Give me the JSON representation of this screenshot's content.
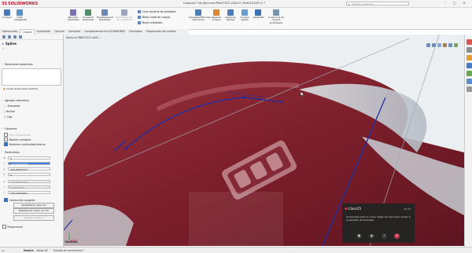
{
  "app": {
    "brand_ds": "3S",
    "brand_name": "SOLIDWORKS",
    "doc_title": "Croquis17 de Ejercicio PRACTICO-CASCO (Pint01)LE(P:1) *",
    "search_placeholder": "Buscar comandos"
  },
  "window": {
    "min": "–",
    "max": "□",
    "close": "✕"
  },
  "ribbon": {
    "big": [
      {
        "label": "Croquis",
        "color": "#4a79b8"
      },
      {
        "label": "Cota inteligente",
        "color": "#5d8fc9"
      },
      {
        "label": "Recortar entidades",
        "color": "#7a6fb0"
      },
      {
        "label": "Convertir entidades",
        "color": "#4d8f6d"
      },
      {
        "label": "Equidistanciar entidades",
        "color": "#6a86b3"
      },
      {
        "label": "Equidistanciar en superficie",
        "color": "#9aa7b8"
      }
    ],
    "small": [
      {
        "label": "Crear simetría de entidades",
        "color": "#5d86c1"
      },
      {
        "label": "Matriz lineal de croquis",
        "color": "#5d86c1"
      },
      {
        "label": "Mover entidades",
        "color": "#5d86c1"
      }
    ],
    "big2": [
      {
        "label": "Visualizar/Eliminar relaciones",
        "color": "#4d7fb5"
      },
      {
        "label": "Reparar croquis",
        "color": "#d48a33"
      },
      {
        "label": "Capturas rápidas",
        "color": "#4d7fb5"
      },
      {
        "label": "Croquis rápido",
        "color": "#6a9bd1"
      },
      {
        "label": "Instant2D",
        "color": "#3b6fb0"
      },
      {
        "label": "Contornos de croquis sombreado",
        "color": "#7a93b0"
      }
    ]
  },
  "tabs": [
    {
      "label": "Operaciones",
      "active": false
    },
    {
      "label": "Croquis",
      "active": true
    },
    {
      "label": "Superficies",
      "active": false
    },
    {
      "label": "Calcular",
      "active": false
    },
    {
      "label": "DimXpert",
      "active": false
    },
    {
      "label": "Complementos de SOLIDWORKS",
      "active": false
    },
    {
      "label": "Simulation",
      "active": false
    },
    {
      "label": "Preparación del análisis",
      "active": false
    }
  ],
  "tree_path": "Ejercicio PRACTICO-CASC...",
  "panel": {
    "title": "Spline",
    "existing_relations_header": "Relaciones existentes",
    "status_text": "Insuficientemente definida",
    "add_relations_header": "Agregar relaciones",
    "relations": [
      "Horizontal",
      "Vertical",
      "Fijar"
    ],
    "options_header": "Opciones",
    "options": [
      {
        "label": "Para construcción",
        "checked": false,
        "disabled": true
      },
      {
        "label": "Mostrar curvatura",
        "checked": false,
        "disabled": false
      },
      {
        "label": "Mantener continuidad interna",
        "checked": true,
        "disabled": false
      }
    ],
    "params_header": "Parámetros",
    "params": [
      {
        "icon": "#",
        "value": "2",
        "style": "normal"
      },
      {
        "icon": "x",
        "value": "-462.58225957",
        "style": "hl"
      },
      {
        "icon": "y",
        "value": "429.30637477",
        "style": "normal"
      },
      {
        "icon": "∠",
        "value": "0",
        "style": "normal"
      },
      {
        "icon": "∠",
        "value": "178.89232704",
        "style": "dis"
      },
      {
        "icon": "↗",
        "value": "0.00000000",
        "style": "dis"
      },
      {
        "icon": "↗",
        "value": "135.33363997",
        "style": "normal"
      }
    ],
    "tangency_label": "Conducción tangente",
    "btn_restore": "Restablecer este ctrl",
    "btn_restore_all": "Restablecer todos los ctrl",
    "btn_relax": "Relajar la spline",
    "proportional_label": "Proporcional"
  },
  "teams": {
    "caller": "Clase15",
    "time": "10:19",
    "message": "La llamada está en curso. Haga clic aquí para volver a la pantalla de llamadas."
  },
  "status_tabs": [
    "Modelo",
    "Vistas 3D",
    "Estudio de movimiento 1"
  ],
  "viewport_label": "*Derecha",
  "colors": {
    "helmet": "#7d1f2b",
    "sketch": "#1c2fa8",
    "accent": "#c8102e"
  }
}
